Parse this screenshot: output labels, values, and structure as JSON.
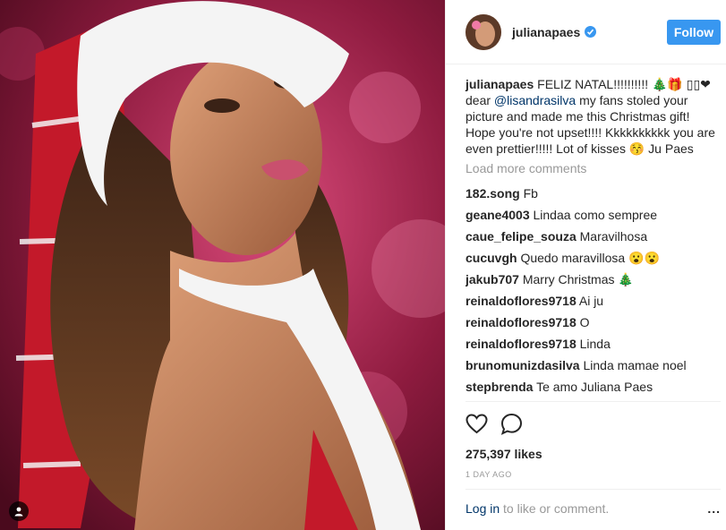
{
  "post": {
    "photo_description_icon": "person-tag-icon"
  },
  "header": {
    "username": "julianapaes",
    "verified_icon": "verified-badge-icon",
    "follow_label": "Follow"
  },
  "caption": {
    "username": "julianapaes",
    "text_part1": "FELIZ NATAL!!!!!!!!!! 🎄🎁 ▯▯❤ dear",
    "mention": "@lisandrasilva",
    "text_part2": "my fans stoled your picture and made me this Christmas gift! Hope you're not upset!!!! Kkkkkkkkkk you are even prettier!!!!! Lot of kisses 😚 Ju Paes"
  },
  "load_more": "Load more comments",
  "comments": [
    {
      "user": "182.song",
      "text": "Fb"
    },
    {
      "user": "geane4003",
      "text": "Lindaa como sempree"
    },
    {
      "user": "caue_felipe_souza",
      "text": "Maravilhosa"
    },
    {
      "user": "cucuvgh",
      "text": "Quedo maravillosa 😮😮"
    },
    {
      "user": "jakub707",
      "text": "Marry Christmas 🎄"
    },
    {
      "user": "reinaldoflores9718",
      "text": "Ai ju"
    },
    {
      "user": "reinaldoflores9718",
      "text": "O"
    },
    {
      "user": "reinaldoflores9718",
      "text": "Linda"
    },
    {
      "user": "brunomunizdasilva",
      "text": "Linda mamae noel"
    },
    {
      "user": "stepbrenda",
      "text": "Te amo Juliana Paes"
    }
  ],
  "actions": {
    "like_icon": "heart-icon",
    "comment_icon": "comment-bubble-icon",
    "likes": "275,397 likes",
    "time": "1 DAY AGO"
  },
  "footer": {
    "login_link": "Log in",
    "login_suffix": " to like or comment.",
    "more_label": "..."
  },
  "colors": {
    "accent": "#3897f0",
    "link": "#003569",
    "muted": "#999999"
  }
}
